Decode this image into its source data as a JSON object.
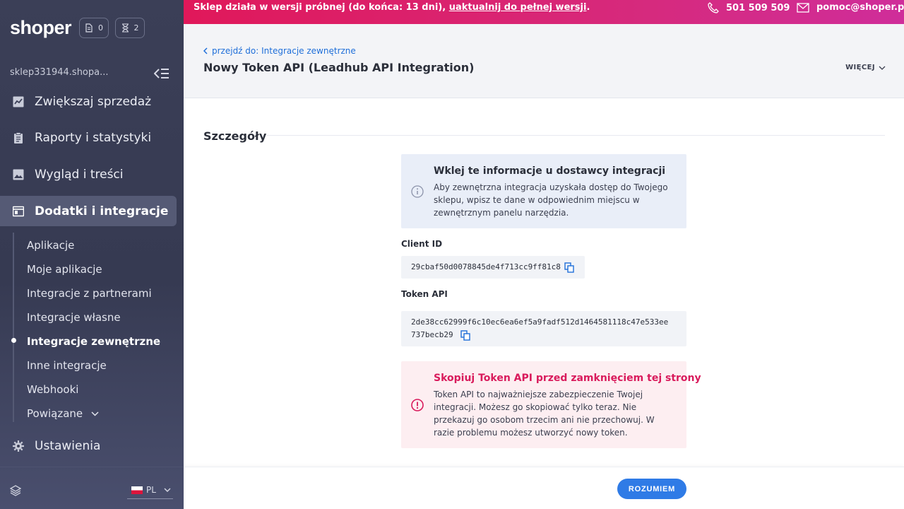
{
  "app": {
    "logo": "shoper",
    "store_name": "sklep331944.shopa..."
  },
  "counters": [
    {
      "icon": "document-icon",
      "value": "0"
    },
    {
      "icon": "hourglass-icon",
      "value": "2"
    }
  ],
  "sidebar": {
    "items": [
      {
        "label": "Zwiększaj sprzedaż",
        "icon": "trend-chart-icon"
      },
      {
        "label": "Raporty i statystyki",
        "icon": "clipboard-icon"
      },
      {
        "label": "Wygląd i treści",
        "icon": "image-icon"
      },
      {
        "label": "Dodatki i integracje",
        "icon": "window-icon"
      },
      {
        "label": "Ustawienia",
        "icon": "gear-icon"
      }
    ],
    "subitems": [
      "Aplikacje",
      "Moje aplikacje",
      "Integracje z partnerami",
      "Integracje własne",
      "Integracje zewnętrzne",
      "Inne integracje",
      "Webhooki",
      "Powiązane"
    ],
    "language": "PL"
  },
  "banner": {
    "message": "Sklep działa w wersji próbnej (do końca: 13 dni), ",
    "link": "uaktualnij do pełnej wersji",
    "suffix": ".",
    "phone": "501 509 509",
    "email": "pomoc@shoper.pl"
  },
  "header": {
    "back": "przejdź do: Integracje zewnętrzne",
    "title": "Nowy Token API (Leadhub API Integration)",
    "more": "WIĘCEJ"
  },
  "details": {
    "section_title": "Szczegóły",
    "info_title": "Wklej te informacje u dostawcy integracji",
    "info_text": "Aby zewnętrzna integracja uzyskała dostęp do Twojego sklepu, wpisz te dane w odpowiednim miejscu w zewnętrznym panelu narzędzia.",
    "client_id_label": "Client ID",
    "client_id": "29cbaf50d0078845de4f713cc9ff81c8",
    "token_label": "Token API",
    "token_line1": "2de38cc62999f6c10ec6ea6ef5a9fadf512d1464581118c47e533ee",
    "token_line2": "737becb29",
    "warn_title": "Skopiuj Token API przed zamknięciem tej strony",
    "warn_text": "Token API to najważniejsze zabezpieczenie Twojej integracji. Możesz go skopiować tylko teraz. Nie przekazuj go osobom trzecim ani nie przechowuj. W razie problemu możesz utworzyć nowy token."
  },
  "footer": {
    "button": "ROZUMIEM"
  },
  "colors": {
    "accent": "#2f7be6",
    "banner": "#e0185a",
    "warning": "#d91b5c",
    "sidebar": "#3b3f57"
  }
}
